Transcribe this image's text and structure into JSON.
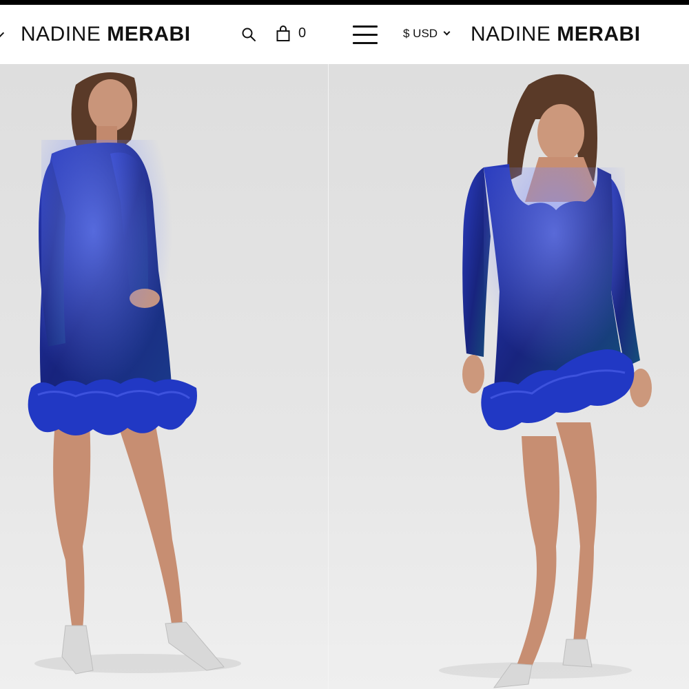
{
  "left_screen": {
    "brand": {
      "light": "NADINE",
      "bold": "MERABI"
    },
    "cart_count": "0",
    "icons": [
      "chevron-left-icon",
      "search-icon",
      "shopping-bag-icon"
    ]
  },
  "right_screen": {
    "currency": "$ USD",
    "brand": {
      "light": "NADINE",
      "bold": "MERABI"
    },
    "icons": [
      "hamburger-menu-icon",
      "chevron-down-icon"
    ]
  },
  "colors": {
    "dress_sequin": "#1f2f9e",
    "feather_trim": "#2138c4",
    "backdrop": "#e3e3e3",
    "skin": "#c9957a",
    "hair": "#5a3a28"
  },
  "photos": [
    {
      "subject": "model-back-view"
    },
    {
      "subject": "model-front-view"
    }
  ]
}
